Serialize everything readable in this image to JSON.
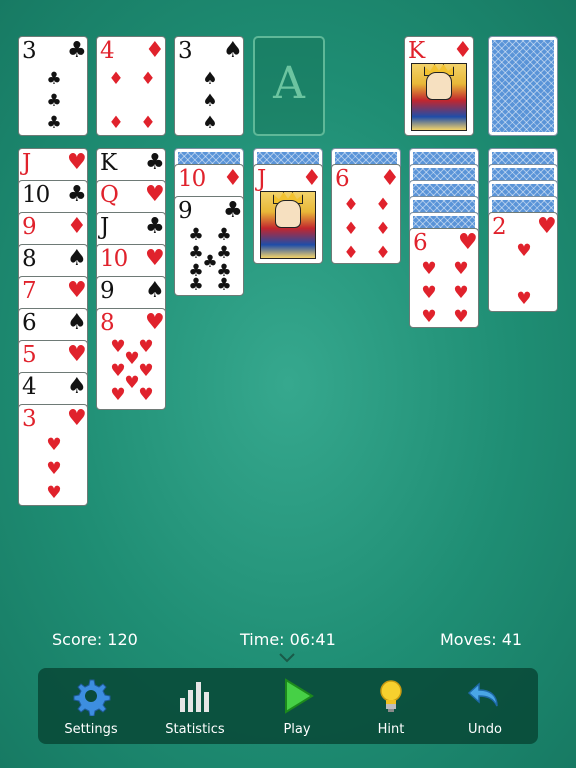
{
  "stock": {
    "face_down": true
  },
  "waste": [
    {
      "rank": "3",
      "suit": "♣",
      "color": "black"
    },
    {
      "rank": "4",
      "suit": "♦",
      "color": "red"
    },
    {
      "rank": "3",
      "suit": "♠",
      "color": "black"
    }
  ],
  "foundation_placeholder": "A",
  "foundation_top": {
    "rank": "K",
    "suit": "♦",
    "color": "red"
  },
  "tableau": {
    "col1": [
      "J",
      "10",
      "9",
      "8",
      "7",
      "6",
      "5",
      "4",
      "3"
    ],
    "col1_suits": [
      "♥",
      "♣",
      "♦",
      "♠",
      "♥",
      "♠",
      "♥",
      "♠",
      "♥"
    ],
    "col2": [
      "K",
      "Q",
      "J",
      "10",
      "9",
      "8"
    ],
    "col2_suits": [
      "♣",
      "♥",
      "♣",
      "♥",
      "♠",
      "♥"
    ],
    "col3": [
      "10",
      "9"
    ],
    "col3_suits": [
      "♦",
      "♣"
    ],
    "col4": [
      "J"
    ],
    "col4_suits": [
      "♦"
    ],
    "col5": [
      "6"
    ],
    "col5_suits": [
      "♦"
    ],
    "col6": [
      "6"
    ],
    "col6_suits": [
      "♥"
    ],
    "col7": [
      "2"
    ],
    "col7_suits": [
      "♥"
    ]
  },
  "status": {
    "score": "Score: 120",
    "time": "Time: 06:41",
    "moves": "Moves: 41"
  },
  "toolbar": {
    "settings": "Settings",
    "statistics": "Statistics",
    "play": "Play",
    "hint": "Hint",
    "undo": "Undo"
  },
  "colors": {
    "felt": "#1f8e74",
    "red_suit": "#e0222c",
    "black_suit": "#121212",
    "card_back": "#5a94d8",
    "toolbar_bg": "#08483a"
  }
}
